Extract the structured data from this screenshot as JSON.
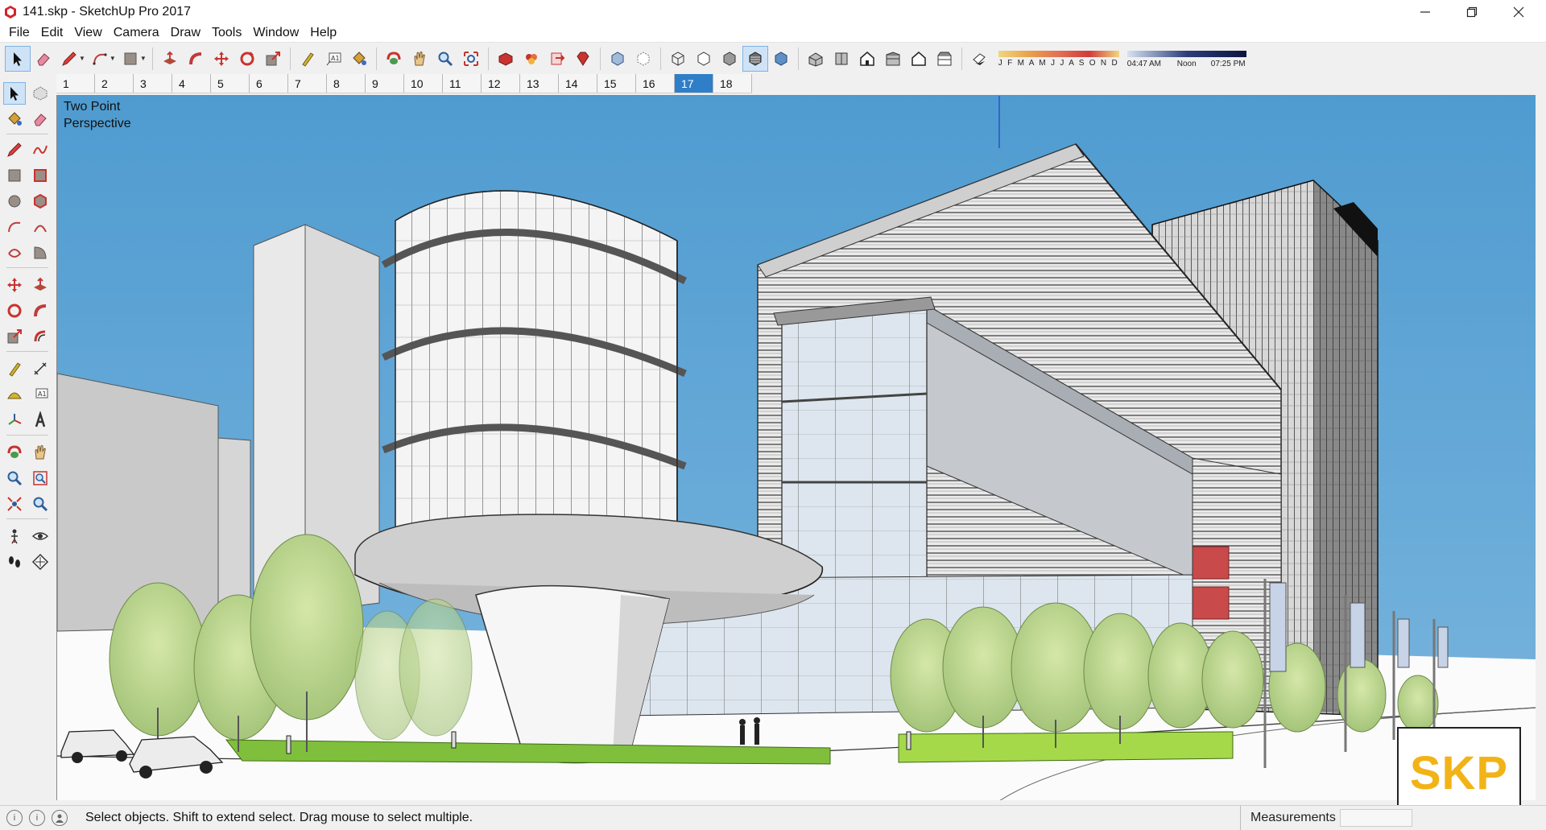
{
  "window": {
    "title": "141.skp - SketchUp Pro 2017",
    "controls": [
      "minimize",
      "restore",
      "close"
    ]
  },
  "menu": [
    "File",
    "Edit",
    "View",
    "Camera",
    "Draw",
    "Tools",
    "Window",
    "Help"
  ],
  "toolbar": {
    "groups": [
      [
        "select-icon",
        "eraser-icon",
        "pencil-icon",
        "arc-icon",
        "rectangle-icon"
      ],
      [
        "push-pull-icon",
        "follow-me-icon",
        "move-icon",
        "rotate-icon",
        "scale-icon"
      ],
      [
        "tape-measure-icon",
        "text-icon",
        "paint-bucket-icon"
      ],
      [
        "orbit-icon",
        "pan-icon",
        "zoom-icon",
        "zoom-extents-icon"
      ],
      [
        "warehouse-icon",
        "extension-warehouse-icon",
        "layout-icon",
        "ruby-icon"
      ],
      [
        "xray-icon",
        "back-edges-icon"
      ],
      [
        "wireframe-icon",
        "hidden-line-icon",
        "shaded-icon",
        "shaded-textures-icon",
        "monochrome-icon"
      ],
      [
        "iso-view-icon",
        "top-view-icon",
        "front-view-icon",
        "right-view-icon",
        "back-view-icon",
        "left-view-icon"
      ],
      [
        "shadows-icon"
      ]
    ],
    "active_tool": "select-icon",
    "active_style": "shaded-textures-icon",
    "shadow": {
      "months": "J F M A M J J A S O N D",
      "time_start": "04:47 AM",
      "time_mid": "Noon",
      "time_end": "07:25 PM"
    }
  },
  "scenes": {
    "tabs": [
      "1",
      "2",
      "3",
      "4",
      "5",
      "6",
      "7",
      "8",
      "9",
      "10",
      "11",
      "12",
      "13",
      "14",
      "15",
      "16",
      "17",
      "18"
    ],
    "selected": "17"
  },
  "palette": {
    "active_tool": "select-icon"
  },
  "viewport": {
    "camera_label_line1": "Two Point",
    "camera_label_line2": "Perspective",
    "sky_color": "#5aa0d3",
    "badge": "SKP"
  },
  "status": {
    "message": "Select objects. Shift to extend select. Drag mouse to select multiple.",
    "measurements_label": "Measurements",
    "measurements_value": ""
  }
}
